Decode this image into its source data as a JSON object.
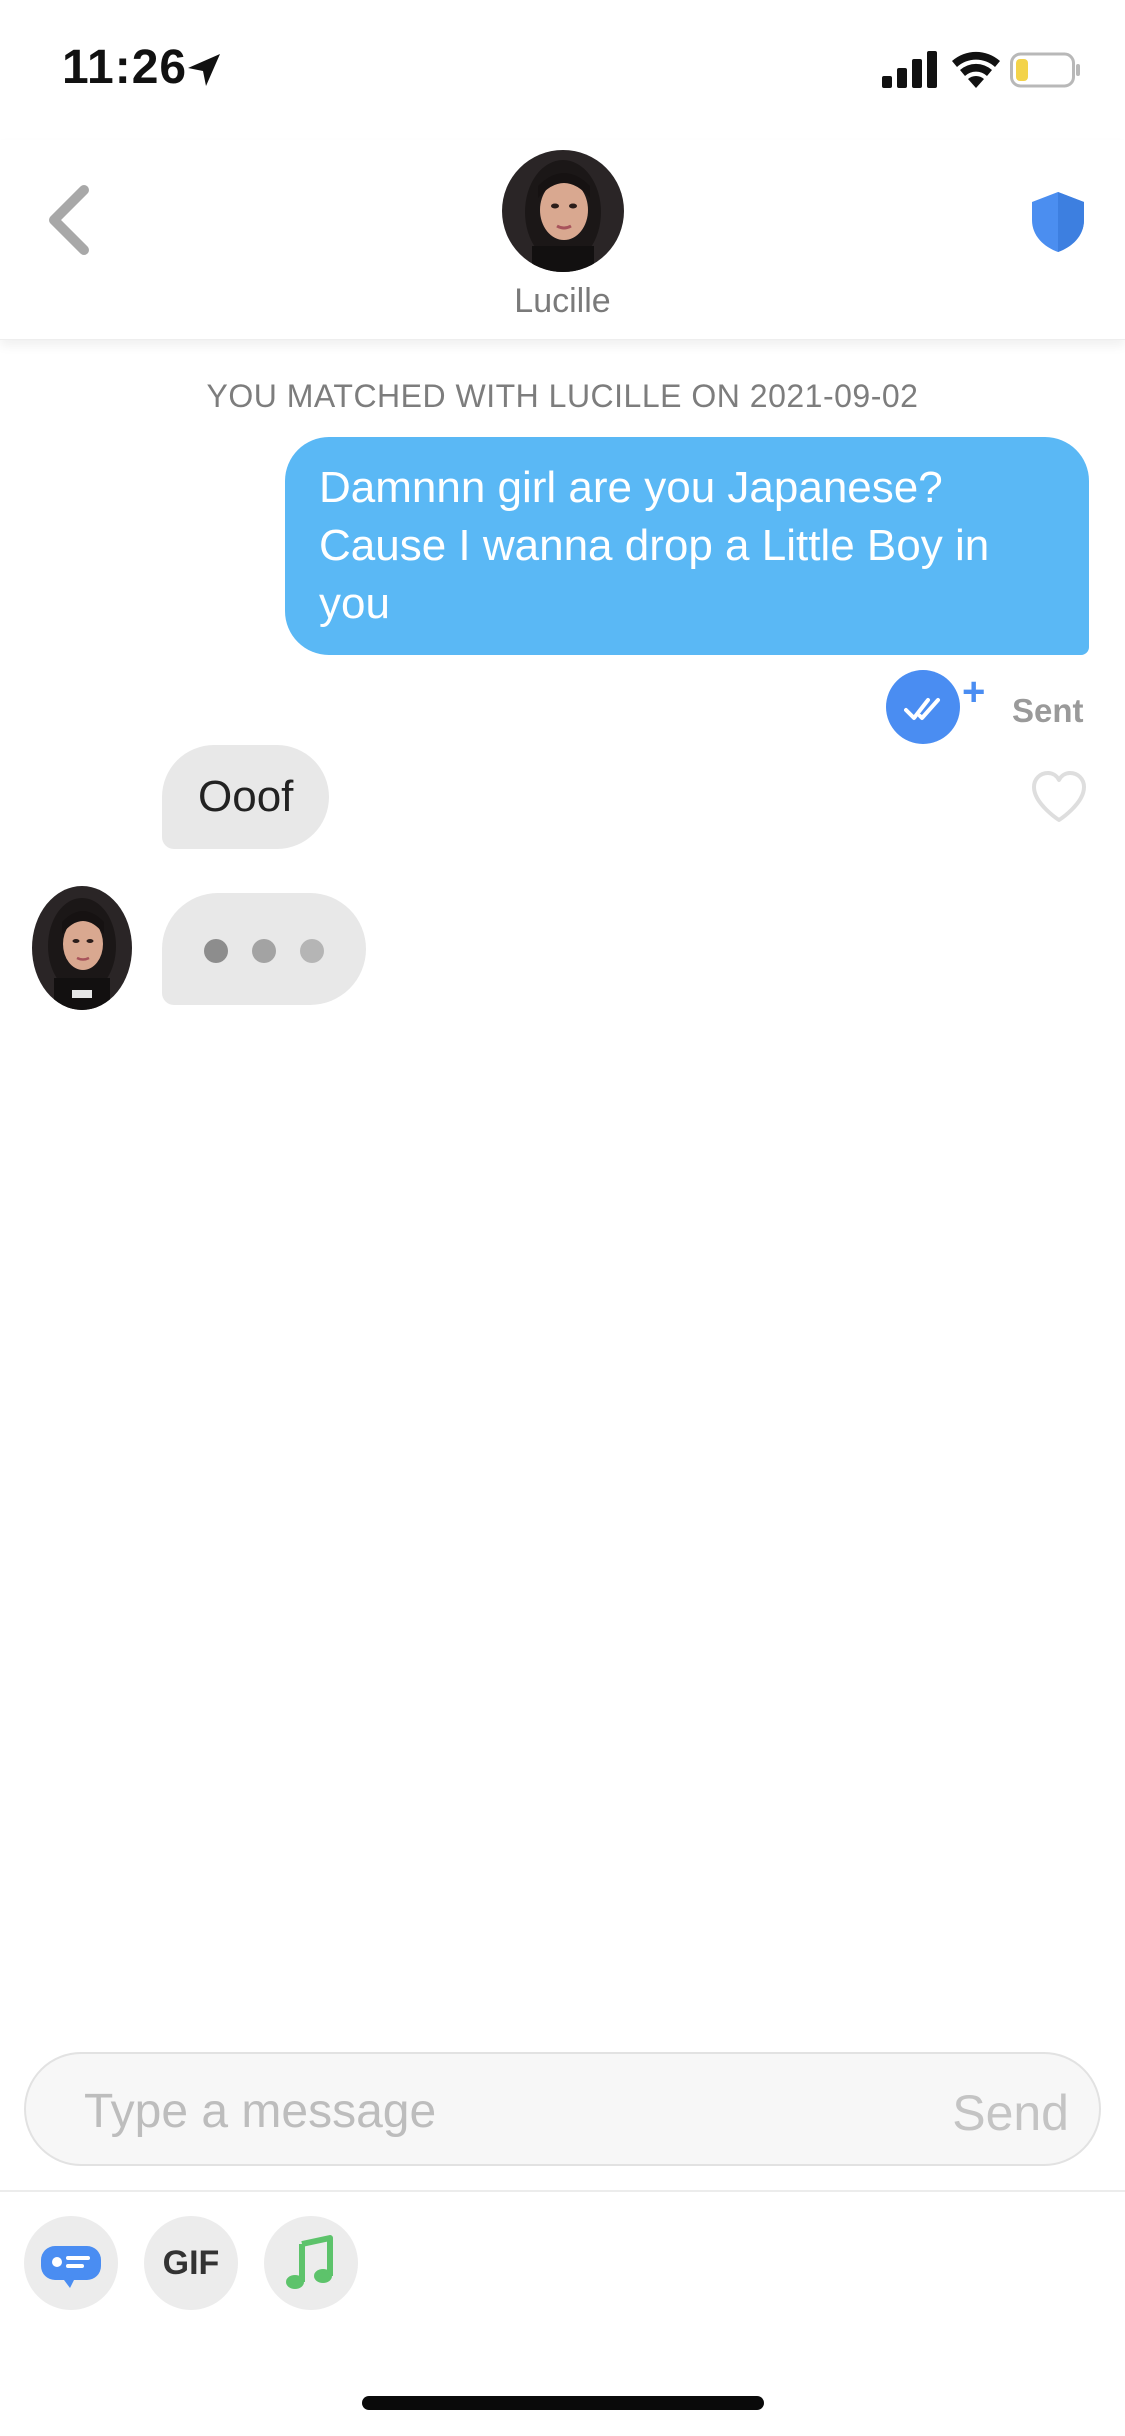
{
  "status_bar": {
    "time": "11:26",
    "location_icon": "location-arrow-icon",
    "signal_icon": "cellular-signal-icon",
    "wifi_icon": "wifi-icon",
    "battery_icon": "battery-low-icon",
    "battery_level": 0.2
  },
  "header": {
    "back_icon": "chevron-left-icon",
    "contact_name": "Lucille",
    "safety_icon": "shield-icon"
  },
  "conversation": {
    "match_banner": "YOU MATCHED WITH LUCILLE ON 2021-09-02",
    "messages": [
      {
        "direction": "sent",
        "text": "Damnnn girl are you Japanese? Cause I wanna drop a Little Boy in you",
        "status": "Sent"
      },
      {
        "direction": "received",
        "text": "Ooof"
      }
    ],
    "read_receipt_icon": "double-check-icon",
    "plus_badge": "+",
    "like_icon": "heart-outline-icon",
    "typing_indicator_icon": "typing-dots-icon"
  },
  "composer": {
    "placeholder": "Type a message",
    "send_label": "Send"
  },
  "toolbar": {
    "sticker_icon": "chat-card-icon",
    "gif_label": "GIF",
    "music_icon": "music-note-icon"
  },
  "colors": {
    "sent_bubble": "#5ab8f5",
    "received_bubble": "#e8e8e8",
    "accent_blue": "#4a8df2",
    "shield_blue": "#4b8ef0",
    "music_green": "#5dc36b",
    "battery_yellow": "#f3d34a"
  }
}
